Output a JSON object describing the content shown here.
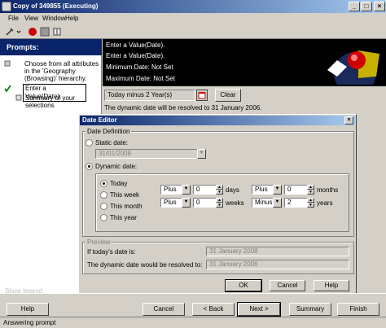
{
  "window": {
    "title": "Copy of 349855 (Executing)",
    "min": "_",
    "max": "□",
    "close": "×"
  },
  "menu": {
    "file": "File",
    "view": "View",
    "window": "Window",
    "help": "Help"
  },
  "prompts": {
    "header": "Prompts:",
    "items": [
      "Choose from all attributes in the 'Geography (Browsing)' hierarchy.",
      "Enter a Value(Date).",
      "Summary of your selections"
    ],
    "show_legend": "Show legend"
  },
  "banner": {
    "line1": "Enter a Value(Date).",
    "line2": "Enter a Value(Date).",
    "min": "Minimum Date: Not Set",
    "max": "Maximum Date: Not Set"
  },
  "date_input": {
    "value": "Today minus  2 Year(s)",
    "clear": "Clear",
    "resolved": "The dynamic date will be resolved to 31 January 2006."
  },
  "dialog": {
    "title": "Date Editor",
    "close": "×",
    "def_group": "Date Definition",
    "static_label": "Static date:",
    "static_value": "31/01/2008",
    "dynamic_label": "Dynamic date:",
    "options": [
      "Today",
      "This week",
      "This month",
      "This year"
    ],
    "row1": {
      "op1": "Plus",
      "val1": "0",
      "unit1": "days",
      "op2": "Plus",
      "val2": "0",
      "unit2": "months"
    },
    "row2": {
      "op1": "Plus",
      "val1": "0",
      "unit1": "weeks",
      "op2": "Minus",
      "val2": "2",
      "unit2": "years"
    },
    "preview_group": "Preview",
    "today_label": "If today's date is:",
    "today_value": "31 January 2008",
    "resolved_label": "The dynamic date would be resolved to:",
    "resolved_value": "31 January 2006",
    "ok": "OK",
    "cancel": "Cancel",
    "help": "Help"
  },
  "bottom": {
    "help": "Help",
    "cancel": "Cancel",
    "back": "< Back",
    "next": "Next >",
    "summary": "Summary",
    "finish": "Finish"
  },
  "status": "Answering prompt"
}
